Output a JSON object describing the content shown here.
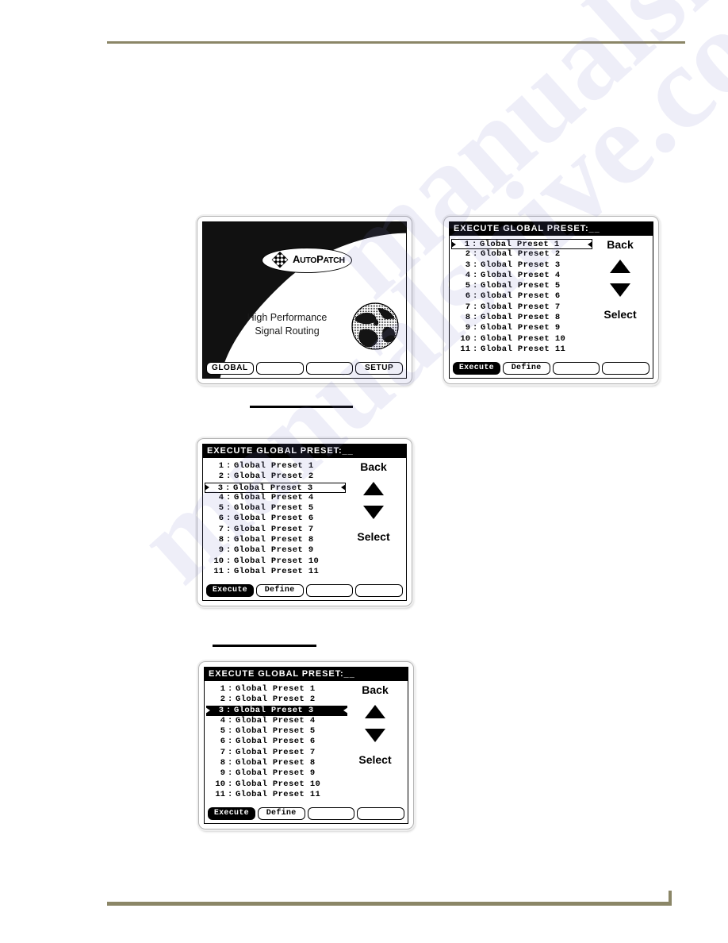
{
  "page": {
    "background_color": "#ffffff",
    "rule_color": "#8b8667",
    "watermark_text": "manualshive.com"
  },
  "splash_screen": {
    "brand": {
      "name_part1": "A",
      "name_part2": "UTO",
      "name_part3": "P",
      "name_part4": "ATCH",
      "full_name": "AutoPatch"
    },
    "tagline_line1": "High Performance",
    "tagline_line2": "Signal Routing",
    "softkeys": [
      {
        "label": "GLOBAL",
        "active": false
      },
      {
        "label": "",
        "active": false
      },
      {
        "label": "",
        "active": false
      },
      {
        "label": "SETUP",
        "active": false
      }
    ]
  },
  "menu_screen_top": {
    "title": "EXECUTE GLOBAL PRESET:__",
    "rows": [
      {
        "index": "1",
        "name": "Global Preset 1",
        "state": "outlined"
      },
      {
        "index": "2",
        "name": "Global Preset 2",
        "state": "normal"
      },
      {
        "index": "3",
        "name": "Global Preset 3",
        "state": "normal"
      },
      {
        "index": "4",
        "name": "Global Preset 4",
        "state": "normal"
      },
      {
        "index": "5",
        "name": "Global Preset 5",
        "state": "normal"
      },
      {
        "index": "6",
        "name": "Global Preset 6",
        "state": "normal"
      },
      {
        "index": "7",
        "name": "Global Preset 7",
        "state": "normal"
      },
      {
        "index": "8",
        "name": "Global Preset 8",
        "state": "normal"
      },
      {
        "index": "9",
        "name": "Global Preset 9",
        "state": "normal"
      },
      {
        "index": "10",
        "name": "Global Preset 10",
        "state": "normal"
      },
      {
        "index": "11",
        "name": "Global Preset 11",
        "state": "normal"
      }
    ],
    "nav": {
      "back_label": "Back",
      "up_icon": "triangle-up-icon",
      "down_icon": "triangle-down-icon",
      "select_label": "Select"
    },
    "softkeys": [
      {
        "label": "Execute",
        "active": true
      },
      {
        "label": "Define",
        "active": false
      },
      {
        "label": "",
        "active": false
      },
      {
        "label": "",
        "active": false
      }
    ]
  },
  "menu_screen_mid": {
    "title": "EXECUTE GLOBAL PRESET:__",
    "rows": [
      {
        "index": "1",
        "name": "Global Preset 1",
        "state": "normal"
      },
      {
        "index": "2",
        "name": "Global Preset 2",
        "state": "normal"
      },
      {
        "index": "3",
        "name": "Global Preset 3",
        "state": "outlined"
      },
      {
        "index": "4",
        "name": "Global Preset 4",
        "state": "normal"
      },
      {
        "index": "5",
        "name": "Global Preset 5",
        "state": "normal"
      },
      {
        "index": "6",
        "name": "Global Preset 6",
        "state": "normal"
      },
      {
        "index": "7",
        "name": "Global Preset 7",
        "state": "normal"
      },
      {
        "index": "8",
        "name": "Global Preset 8",
        "state": "normal"
      },
      {
        "index": "9",
        "name": "Global Preset 9",
        "state": "normal"
      },
      {
        "index": "10",
        "name": "Global Preset 10",
        "state": "normal"
      },
      {
        "index": "11",
        "name": "Global Preset 11",
        "state": "normal"
      }
    ],
    "nav": {
      "back_label": "Back",
      "up_icon": "triangle-up-icon",
      "down_icon": "triangle-down-icon",
      "select_label": "Select"
    },
    "softkeys": [
      {
        "label": "Execute",
        "active": true
      },
      {
        "label": "Define",
        "active": false
      },
      {
        "label": "",
        "active": false
      },
      {
        "label": "",
        "active": false
      }
    ]
  },
  "menu_screen_bot": {
    "title": "EXECUTE GLOBAL PRESET:__",
    "rows": [
      {
        "index": "1",
        "name": "Global Preset 1",
        "state": "normal"
      },
      {
        "index": "2",
        "name": "Global Preset 2",
        "state": "normal"
      },
      {
        "index": "3",
        "name": "Global Preset 3",
        "state": "inverted"
      },
      {
        "index": "4",
        "name": "Global Preset 4",
        "state": "normal"
      },
      {
        "index": "5",
        "name": "Global Preset 5",
        "state": "normal"
      },
      {
        "index": "6",
        "name": "Global Preset 6",
        "state": "normal"
      },
      {
        "index": "7",
        "name": "Global Preset 7",
        "state": "normal"
      },
      {
        "index": "8",
        "name": "Global Preset 8",
        "state": "normal"
      },
      {
        "index": "9",
        "name": "Global Preset 9",
        "state": "normal"
      },
      {
        "index": "10",
        "name": "Global Preset 10",
        "state": "normal"
      },
      {
        "index": "11",
        "name": "Global Preset 11",
        "state": "normal"
      }
    ],
    "nav": {
      "back_label": "Back",
      "up_icon": "triangle-up-icon",
      "down_icon": "triangle-down-icon",
      "select_label": "Select"
    },
    "softkeys": [
      {
        "label": "Execute",
        "active": true
      },
      {
        "label": "Define",
        "active": false
      },
      {
        "label": "",
        "active": false
      },
      {
        "label": "",
        "active": false
      }
    ]
  }
}
